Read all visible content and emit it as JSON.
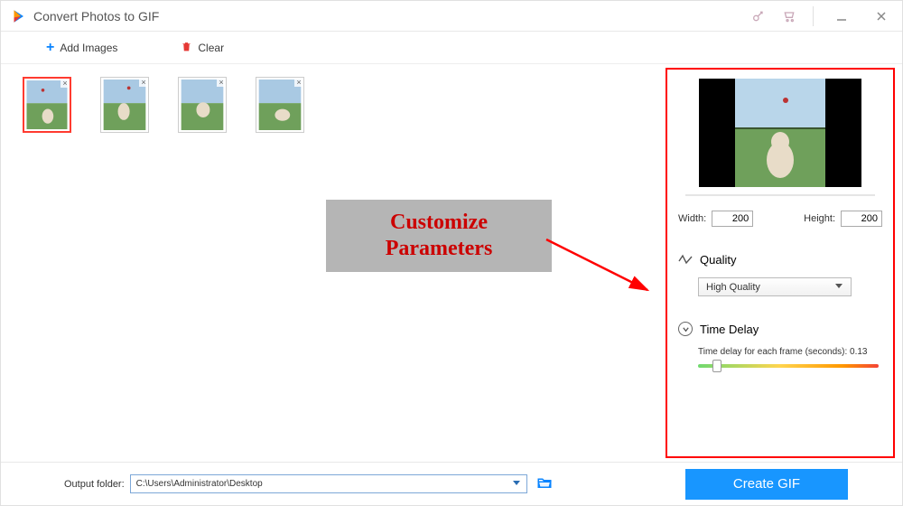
{
  "window": {
    "title": "Convert Photos to GIF"
  },
  "toolbar": {
    "add_label": "Add Images",
    "clear_label": "Clear"
  },
  "thumbs": {
    "count": 4,
    "selected": 0
  },
  "annotation": {
    "line1": "Customize",
    "line2": "Parameters"
  },
  "preview": {
    "width_label": "Width:",
    "width_value": "200",
    "height_label": "Height:",
    "height_value": "200"
  },
  "quality": {
    "header": "Quality",
    "selected": "High Quality"
  },
  "delay": {
    "header": "Time Delay",
    "desc_prefix": "Time delay for each frame (seconds):",
    "value": "0.13"
  },
  "output": {
    "label": "Output folder:",
    "path": "C:\\Users\\Administrator\\Desktop"
  },
  "actions": {
    "create_label": "Create GIF"
  },
  "icons": {
    "add": "plus-icon",
    "clear": "trash-icon",
    "key": "key-icon",
    "cart": "cart-icon",
    "minimize": "minimize-icon",
    "close": "close-icon",
    "quality": "wave-icon",
    "delay": "circle-down-icon",
    "dropdown": "chevron-down-icon",
    "folder": "folder-open-icon"
  }
}
